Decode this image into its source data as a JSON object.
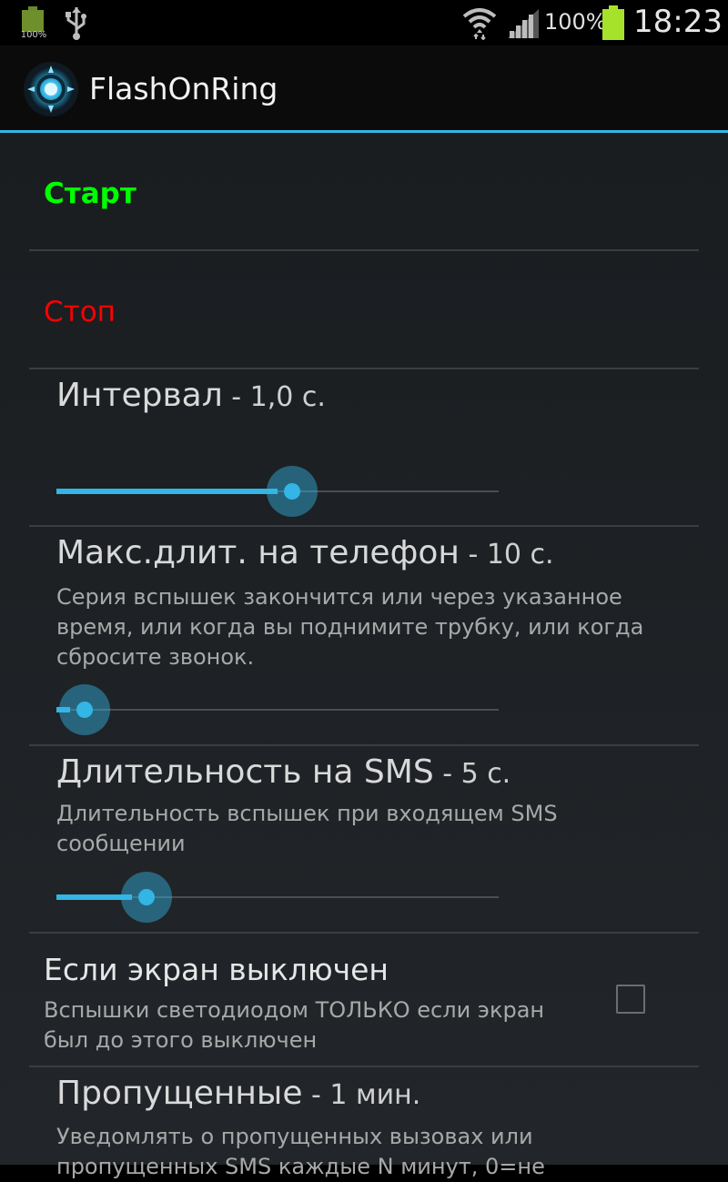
{
  "status_bar": {
    "left_battery_text": "100%",
    "battery_percent": "100%",
    "time": "18:23",
    "icons": [
      "battery-charging-icon",
      "usb-icon",
      "wifi-icon",
      "signal-icon",
      "battery-icon"
    ]
  },
  "action_bar": {
    "title": "FlashOnRing",
    "icon": "app-logo-icon"
  },
  "colors": {
    "accent": "#33b5e5",
    "start": "#00ff00",
    "stop": "#ff0000"
  },
  "prefs": {
    "start": {
      "label": "Старт"
    },
    "stop": {
      "label": "Стоп"
    },
    "interval": {
      "title": "Интервал",
      "value": " - 1,0 с.",
      "level": 0.5
    },
    "max_phone": {
      "title": "Макс.длит. на телефон",
      "value": " - 10 с.",
      "summary": "Серия вспышек закончится или через указанное время, или когда вы поднимите трубку, или когда сбросите звонок.",
      "level": 0.03
    },
    "sms": {
      "title": "Длительность на SMS",
      "value": " - 5 с.",
      "summary": "Длительность вспышек при входящем SMS сообщении",
      "level": 0.17
    },
    "screen_off": {
      "title": "Если экран выключен",
      "summary": "Вспышки светодиодом ТОЛЬКО если экран был до этого выключен",
      "checked": false
    },
    "missed": {
      "title": "Пропущенные",
      "value": " - 1 мин.",
      "summary": "Уведомлять о пропущенных вызовах или пропущенных SMS каждые N минут, 0=не"
    }
  }
}
